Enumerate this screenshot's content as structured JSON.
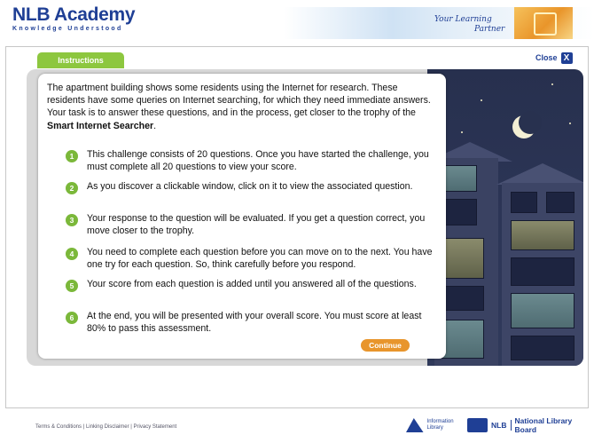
{
  "header": {
    "logo_title": "NLB Academy",
    "logo_subtitle": "Knowledge Understood",
    "tagline_1": "Your Learning",
    "tagline_2": "Partner"
  },
  "tab_label": "Instructions",
  "close_label": "Close",
  "close_icon": "X",
  "intro": {
    "text": "The apartment building shows some residents using the Internet for research. These residents have some queries on Internet searching, for which they need immediate answers. Your task is to answer these questions, and in the process, get closer to the trophy of the ",
    "bold": "Smart Internet Searcher",
    "end": "."
  },
  "instructions": [
    {
      "num": "1",
      "text": "This challenge consists of 20 questions. Once you have started the challenge, you must complete all 20 questions to view your score."
    },
    {
      "num": "2",
      "text": "As you discover a clickable window, click on it to view the associated question."
    },
    {
      "num": "3",
      "text": "Your response to the question will be evaluated. If you get a question correct, you move closer to the trophy."
    },
    {
      "num": "4",
      "text": "You need to complete each question before you can move on to the next. You have one try for each question.  So, think carefully before you respond."
    },
    {
      "num": "5",
      "text": "Your score from each question is added until you answered all of the questions."
    },
    {
      "num": "6",
      "text": "At the end, you will be presented with your overall score. You must score at least 80% to pass this assessment."
    }
  ],
  "continue_label": "Continue",
  "footer": {
    "terms": "Terms & Conditions",
    "sep1": " | ",
    "disclaimer": "Linking Disclaimer",
    "sep2": " | ",
    "privacy": "Privacy Statement",
    "infolib": "Information Library",
    "nlb_short": "NLB",
    "nlb": "National Library Board"
  },
  "colors": {
    "brand_blue": "#1f3f95",
    "accent_green": "#8dc73f",
    "button_orange": "#e8952c"
  }
}
